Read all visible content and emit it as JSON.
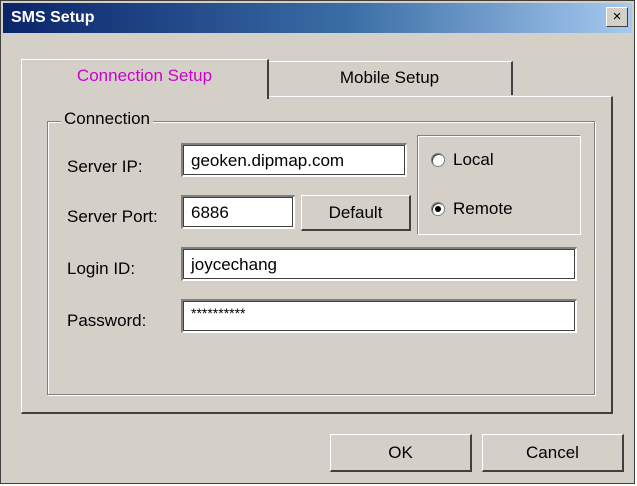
{
  "window": {
    "title": "SMS Setup",
    "close_glyph": "×",
    "icons": {
      "close": "close-icon"
    }
  },
  "tabs": [
    {
      "label": "Connection Setup",
      "active": true,
      "color": "#cc00cc"
    },
    {
      "label": "Mobile Setup",
      "active": false
    }
  ],
  "connection": {
    "group_label": "Connection",
    "server_ip_label": "Server IP:",
    "server_ip_value": "geoken.dipmap.com",
    "server_port_label": "Server Port:",
    "server_port_value": "6886",
    "default_button": "Default",
    "login_id_label": "Login ID:",
    "login_id_value": "joycechang",
    "password_label": "Password:",
    "password_value": "**********",
    "mode_options": [
      {
        "label": "Local",
        "selected": false
      },
      {
        "label": "Remote",
        "selected": true
      }
    ]
  },
  "buttons": {
    "ok": "OK",
    "cancel": "Cancel"
  }
}
